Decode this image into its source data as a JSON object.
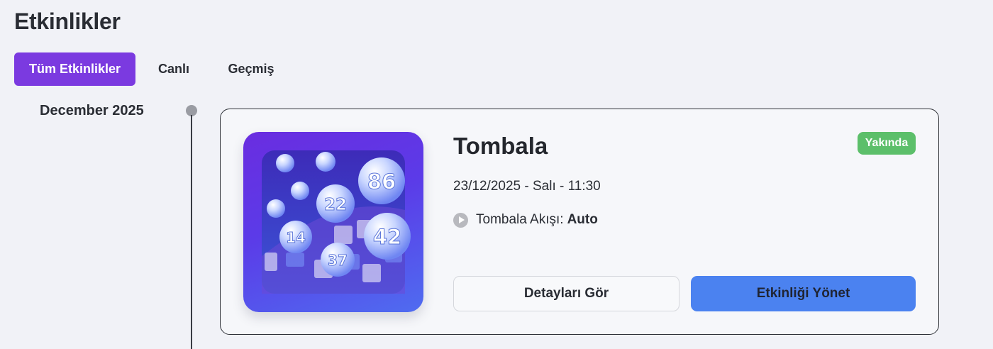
{
  "page": {
    "title": "Etkinlikler"
  },
  "tabs": [
    {
      "label": "Tüm Etkinlikler",
      "active": true
    },
    {
      "label": "Canlı",
      "active": false
    },
    {
      "label": "Geçmiş",
      "active": false
    }
  ],
  "timeline": {
    "month": "December 2025",
    "events": [
      {
        "title": "Tombala",
        "status": "Yakında",
        "status_color": "#5cbf6a",
        "date": "23/12/2025 - Salı - 11:30",
        "flow_label": "Tombala Akışı:",
        "flow_value": "Auto",
        "flow_icon": "play-circle-icon",
        "thumbnail_numbers": [
          "86",
          "22",
          "14",
          "42",
          "37"
        ],
        "details_button": "Detayları Gör",
        "manage_button": "Etkinliği Yönet"
      }
    ]
  },
  "colors": {
    "accent": "#7b3ae0",
    "primary_button": "#4b82f0",
    "background": "#f1f2f7"
  }
}
